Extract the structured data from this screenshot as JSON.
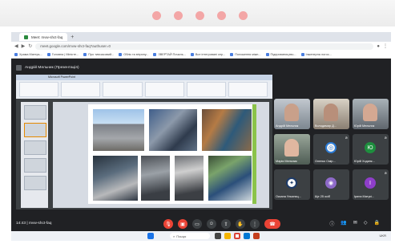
{
  "browser": {
    "tab_title": "Meet: mvw-shct-faq",
    "new_tab_symbol": "+",
    "url": "meet.google.com/mvw-shct-faq?authuser=0",
    "bookmarks": [
      "Храма Матерь...",
      "Головна | Міністе...",
      "Про тимчасовий...",
      "Облік та вітрину...",
      "ЗВЕРТАЙ Почаль...",
      "Все інтегровані сер...",
      "Положення міжн...",
      "Підприємництво...",
      "Інженерна логос..."
    ]
  },
  "meet": {
    "presenter_label": "Андрій Мельник (Презентація)",
    "meeting_time": "14:43",
    "meeting_code": "mvw-shct-faq",
    "participants": [
      {
        "name": "Андрій Мельник"
      },
      {
        "name": "Володимир Д..."
      },
      {
        "name": "Юрій Мельник"
      },
      {
        "name": "Марія Мельник"
      },
      {
        "name": "Оленко Смір..."
      },
      {
        "name": "Юрій Ходинк...",
        "initial": "Ю",
        "color": "#1e8e3e"
      },
      {
        "name": "Оксана Ульяниц..."
      },
      {
        "name": "Ще 25 осіб"
      },
      {
        "name": "Ірина Матусі...",
        "initial": "I",
        "color": "#8e3ec9"
      }
    ]
  },
  "powerpoint": {
    "window_title": "Microsoft PowerPoint"
  },
  "taskbar": {
    "search_label": "Пошук",
    "tray_text": "UKR"
  }
}
